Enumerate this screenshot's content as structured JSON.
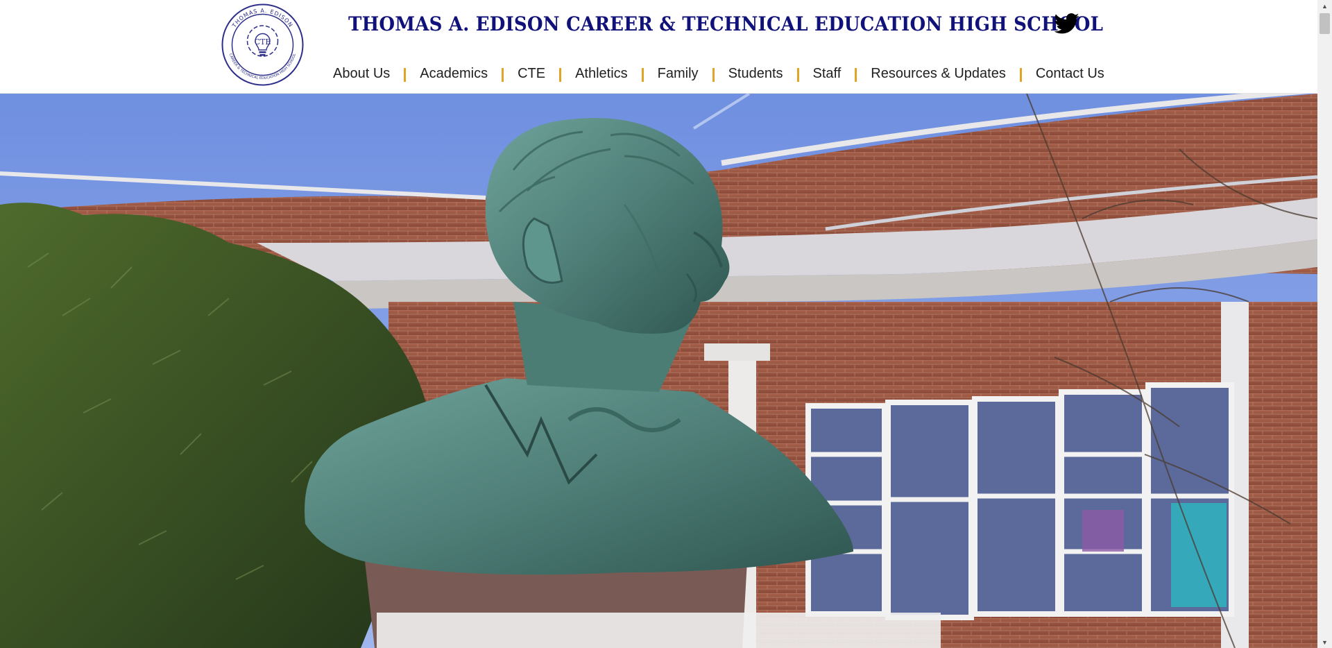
{
  "header": {
    "logo": {
      "ring_text": "THOMAS A. EDISON",
      "ring_text_bottom": "CAREER & TECHNICAL EDUCATION HIGH SCHOOL",
      "center_text": "CTE"
    },
    "title": "THOMAS A. EDISON CAREER & TECHNICAL EDUCATION HIGH SCHOOL",
    "social_icon": "twitter-icon",
    "colors": {
      "brand": "#10127a",
      "separator": "#e0a526"
    }
  },
  "nav": {
    "items": [
      {
        "label": "About Us"
      },
      {
        "label": "Academics"
      },
      {
        "label": "CTE"
      },
      {
        "label": "Athletics"
      },
      {
        "label": "Family"
      },
      {
        "label": "Students"
      },
      {
        "label": "Staff"
      },
      {
        "label": "Resources & Updates"
      },
      {
        "label": "Contact Us"
      }
    ]
  },
  "hero": {
    "image": "Bronze bust of Thomas A. Edison in front of a red brick school building"
  }
}
